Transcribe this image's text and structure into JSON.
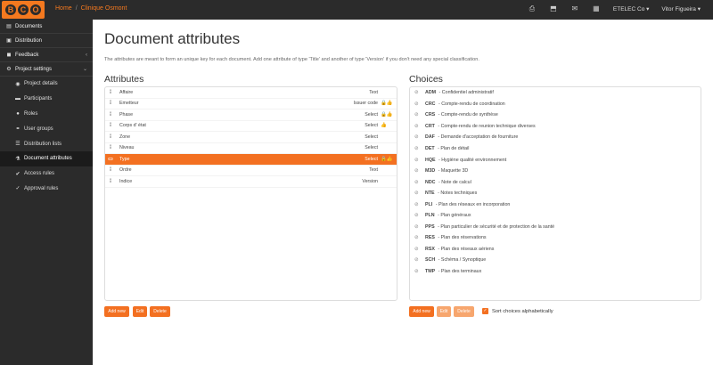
{
  "navbar": {
    "logo_letters": [
      "B",
      "C",
      "O"
    ],
    "breadcrumb": {
      "home": "Home",
      "separator": "/",
      "current": "Clinique Osmont"
    },
    "icons": [
      "print-icon",
      "export-icon",
      "mail-icon",
      "calendar-icon"
    ],
    "org_menu": "ETELEC Co ▾",
    "user_menu": "Vitor Figueira ▾"
  },
  "sidebar": {
    "items": [
      {
        "label": "Documents",
        "icon": "folder-icon"
      },
      {
        "label": "Distribution",
        "icon": "cube-icon"
      },
      {
        "label": "Feedback",
        "icon": "comment-icon",
        "chevron": "‹"
      },
      {
        "label": "Project settings",
        "icon": "gear-icon",
        "chevron": "⌄"
      }
    ],
    "subitems": [
      {
        "label": "Project details",
        "icon": "eye-icon"
      },
      {
        "label": "Participants",
        "icon": "briefcase-icon"
      },
      {
        "label": "Roles",
        "icon": "user-icon"
      },
      {
        "label": "User groups",
        "icon": "users-icon"
      },
      {
        "label": "Distribution lists",
        "icon": "list-icon"
      },
      {
        "label": "Document attributes",
        "icon": "flask-icon",
        "active": true
      },
      {
        "label": "Access rules",
        "icon": "check-icon"
      },
      {
        "label": "Approval rules",
        "icon": "approve-icon"
      }
    ]
  },
  "main": {
    "title": "Document attributes",
    "intro": "The attributes are meant to form an unique key for each document. Add one attribute of type 'Title' and another of type 'Version' if you don't need any special classification.",
    "attributes": {
      "heading": "Attributes",
      "rows": [
        {
          "name": "Affaire",
          "type": "Text",
          "flags": ""
        },
        {
          "name": "Emetteur",
          "type": "Issuer code",
          "flags": "🔒👍"
        },
        {
          "name": "Phase",
          "type": "Select",
          "flags": "🔒👍"
        },
        {
          "name": "Corps d' état",
          "type": "Select",
          "flags": "👍"
        },
        {
          "name": "Zone",
          "type": "Select",
          "flags": ""
        },
        {
          "name": "Niveau",
          "type": "Select",
          "flags": ""
        },
        {
          "name": "Type",
          "type": "Select",
          "flags": "🔒👍",
          "selected": true
        },
        {
          "name": "Ordre",
          "type": "Text",
          "flags": ""
        },
        {
          "name": "Indice",
          "type": "Version",
          "flags": ""
        }
      ],
      "buttons": {
        "add": "Add new",
        "edit": "Edit",
        "delete": "Delete"
      }
    },
    "choices": {
      "heading": "Choices",
      "rows": [
        {
          "code": "ADM",
          "label": "Confidentiel administratif"
        },
        {
          "code": "CRC",
          "label": "Compte-rendu de coordination"
        },
        {
          "code": "CRS",
          "label": "Compte-rendu de synthèse"
        },
        {
          "code": "CRT",
          "label": "Compte-rendu de reunion technique diverses"
        },
        {
          "code": "DAF",
          "label": "Demande d'acceptation de fourniture"
        },
        {
          "code": "DET",
          "label": "Plan de détail"
        },
        {
          "code": "HQE",
          "label": "Hygiène qualité environnement"
        },
        {
          "code": "M3D",
          "label": "Maquette 3D"
        },
        {
          "code": "NDC",
          "label": "Note de calcul"
        },
        {
          "code": "NTE",
          "label": "Notes techniques"
        },
        {
          "code": "PLI",
          "label": "Plan des réseaux en incorporation"
        },
        {
          "code": "PLN",
          "label": "Plan généraux"
        },
        {
          "code": "PPS",
          "label": "Plan particulier de sécurité et de protection de la santé"
        },
        {
          "code": "RES",
          "label": "Plan des réservations"
        },
        {
          "code": "RSX",
          "label": "Plan des réseaux aériens"
        },
        {
          "code": "SCH",
          "label": "Schéma / Synoptique"
        },
        {
          "code": "TMP",
          "label": "Plan des terminaux"
        }
      ],
      "buttons": {
        "add": "Add new",
        "edit": "Edit",
        "delete": "Delete"
      },
      "sort_label": "Sort choices alphabetically",
      "sort_checked": true
    }
  },
  "colors": {
    "accent": "#f37021",
    "sidebar_bg": "#2b2b2b",
    "navbar_bg": "#2b2b2b"
  }
}
